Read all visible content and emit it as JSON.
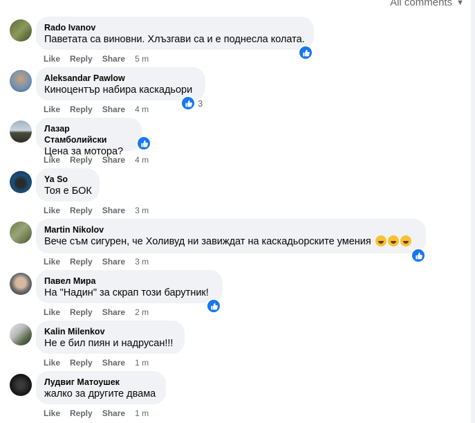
{
  "header": {
    "filter_label": "All comments"
  },
  "actions": {
    "like": "Like",
    "reply": "Reply",
    "share": "Share"
  },
  "comments": [
    {
      "author": "Rado Ivanov",
      "text": "Паветата са виновни. Хлъзгави са и е поднесла колата.",
      "time": "5 m",
      "reaction_count": ""
    },
    {
      "author": "Aleksandar Pawlow",
      "text": "Киноцентър набира каскадьори",
      "time": "4 m",
      "reaction_count": "3"
    },
    {
      "author": "Лазар Стамболийски",
      "text": "Цена за мотора?",
      "time": "4 m",
      "reaction_count": ""
    },
    {
      "author": "Ya So",
      "text": "Тоя е БОК",
      "time": "3 m",
      "reaction_count": ""
    },
    {
      "author": "Martin Nikolov",
      "text": "Вече съм сигурен, че Холивуд ни завиждат на каскадьорските умения",
      "time": "3 m",
      "reaction_count": ""
    },
    {
      "author": "Павел Мира",
      "text": "На \"Надин\" за скрап този барутник!",
      "time": "2 m",
      "reaction_count": ""
    },
    {
      "author": "Kalin Milenkov",
      "text": "Не е бил пиян и надрусан!!!",
      "time": "1 m",
      "reaction_count": ""
    },
    {
      "author": "Лудвиг Матоушек",
      "text": "жалко за другите двама",
      "time": "1 m",
      "reaction_count": ""
    }
  ],
  "colors": {
    "like_blue": "#1877f2",
    "bubble": "#f0f2f5",
    "meta": "#65676b"
  }
}
